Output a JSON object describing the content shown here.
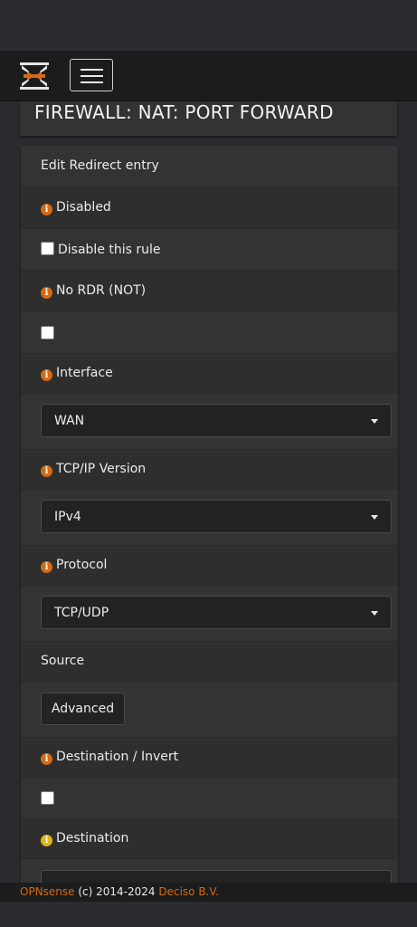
{
  "header": {
    "menu_toggle_icon": "hamburger-menu-icon",
    "logo_icon": "opnsense-logo-icon"
  },
  "page": {
    "title": "FIREWALL: NAT: PORT FORWARD"
  },
  "form": {
    "heading": "Edit Redirect entry",
    "disabled": {
      "label": "Disabled",
      "checkbox_label": "Disable this rule",
      "checked": false
    },
    "nordr": {
      "label": "No RDR (NOT)",
      "checked": false
    },
    "interface": {
      "label": "Interface",
      "value": "WAN"
    },
    "ipversion": {
      "label": "TCP/IP Version",
      "value": "IPv4"
    },
    "protocol": {
      "label": "Protocol",
      "value": "TCP/UDP"
    },
    "source": {
      "label": "Source",
      "advanced_button": "Advanced"
    },
    "destination_invert": {
      "label": "Destination / Invert",
      "checked": false
    },
    "destination": {
      "label": "Destination"
    }
  },
  "footer": {
    "brand": "OPNsense",
    "copyright": " (c) 2014-2024 ",
    "company": "Deciso B.V."
  },
  "colors": {
    "accent": "#d56a16",
    "info_yellow": "#e0b516",
    "panel": "#333333",
    "navbar": "#1c1c1c"
  }
}
